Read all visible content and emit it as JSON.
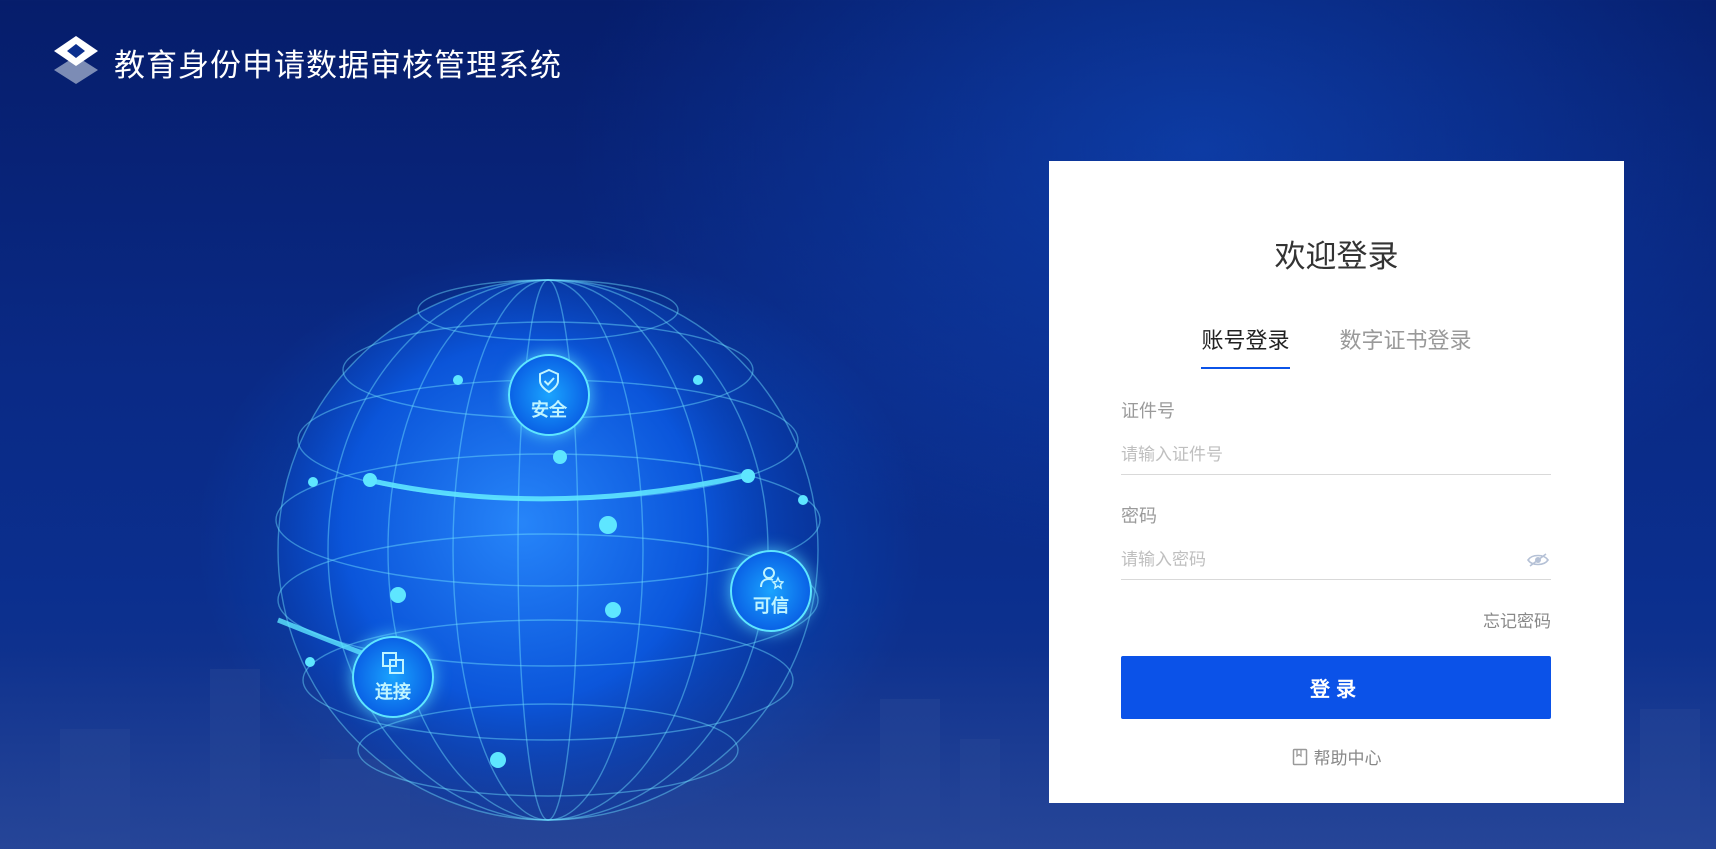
{
  "header": {
    "title": "教育身份申请数据审核管理系统",
    "logo_icon": "layers-diamond-icon"
  },
  "globe": {
    "badges": [
      {
        "label": "安全",
        "icon": "shield-check-icon"
      },
      {
        "label": "可信",
        "icon": "user-star-icon"
      },
      {
        "label": "连接",
        "icon": "link-squares-icon"
      }
    ]
  },
  "login": {
    "welcome": "欢迎登录",
    "tabs": [
      {
        "label": "账号登录",
        "active": true
      },
      {
        "label": "数字证书登录",
        "active": false
      }
    ],
    "id_field": {
      "label": "证件号",
      "placeholder": "请输入证件号",
      "value": ""
    },
    "password_field": {
      "label": "密码",
      "placeholder": "请输入密码",
      "value": "",
      "toggle_icon": "eye-hidden-icon"
    },
    "forgot_label": "忘记密码",
    "submit_label": "登录",
    "help_label": "帮助中心",
    "help_icon": "book-icon"
  },
  "colors": {
    "primary": "#0b52e8",
    "background_dark": "#061d6b",
    "badge_glow": "#5ee6ff"
  }
}
